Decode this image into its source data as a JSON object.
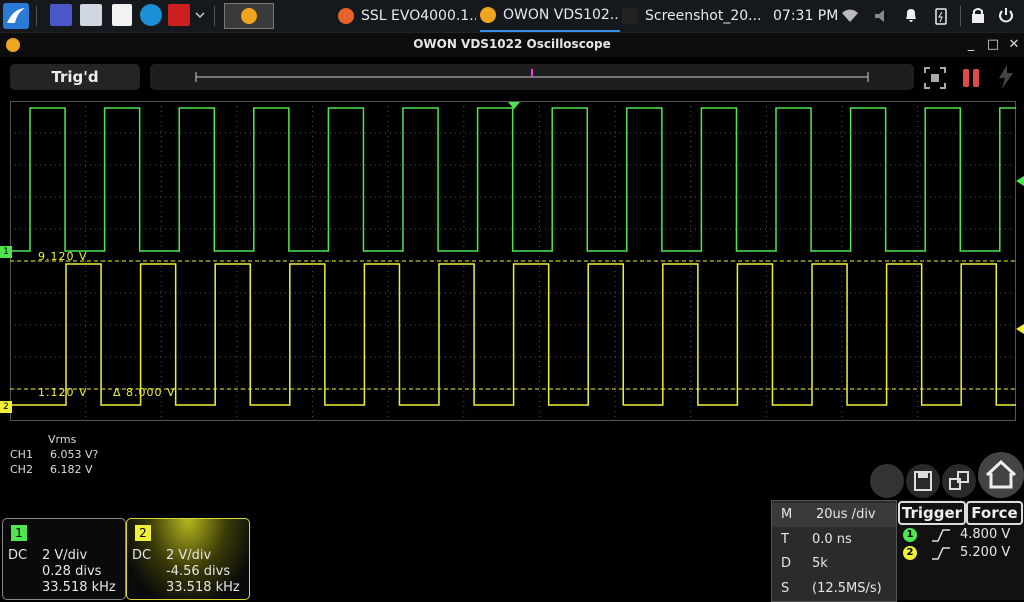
{
  "taskbar": {
    "tasks": [
      {
        "label": "SSL EVO4000.1..."
      },
      {
        "label": "OWON VDS102..."
      },
      {
        "label": "Screenshot_20..."
      }
    ],
    "clock": "07:31 PM"
  },
  "window": {
    "title": "OWON VDS1022 Oscilloscope",
    "minimize": "_",
    "maximize": "□",
    "close": "✕"
  },
  "status": {
    "trig_state": "Trig'd"
  },
  "scope": {
    "cursor_a_label": "9.120 V",
    "cursor_b_label": "1.120 V",
    "cursor_delta_label": "Δ 8.000 V",
    "ch1_marker": "1",
    "ch2_marker": "2",
    "colors": {
      "ch1": "#4fe64f",
      "ch2": "#f0f03a",
      "grid": "#555555"
    }
  },
  "measurements": {
    "header": "Vrms",
    "rows": [
      {
        "ch": "CH1",
        "value": "6.053 V?"
      },
      {
        "ch": "CH2",
        "value": "6.182 V"
      }
    ]
  },
  "channels": [
    {
      "num": "1",
      "coupling": "DC",
      "vdiv": "2 V/div",
      "offset": "0.28 divs",
      "freq": "33.518 kHz"
    },
    {
      "num": "2",
      "coupling": "DC",
      "vdiv": "2 V/div",
      "offset": "-4.56 divs",
      "freq": "33.518 kHz"
    }
  ],
  "timebase": {
    "rows": [
      {
        "k": "M",
        "v": "20us /div"
      },
      {
        "k": "T",
        "v": "0.0 ns"
      },
      {
        "k": "D",
        "v": "5k"
      },
      {
        "k": "S",
        "v": "(12.5MS/s)"
      }
    ]
  },
  "trigger": {
    "trigger_label": "Trigger",
    "force_label": "Force",
    "levels": [
      {
        "ch": "1",
        "value": "4.800 V"
      },
      {
        "ch": "2",
        "value": "5.200 V"
      }
    ]
  }
}
